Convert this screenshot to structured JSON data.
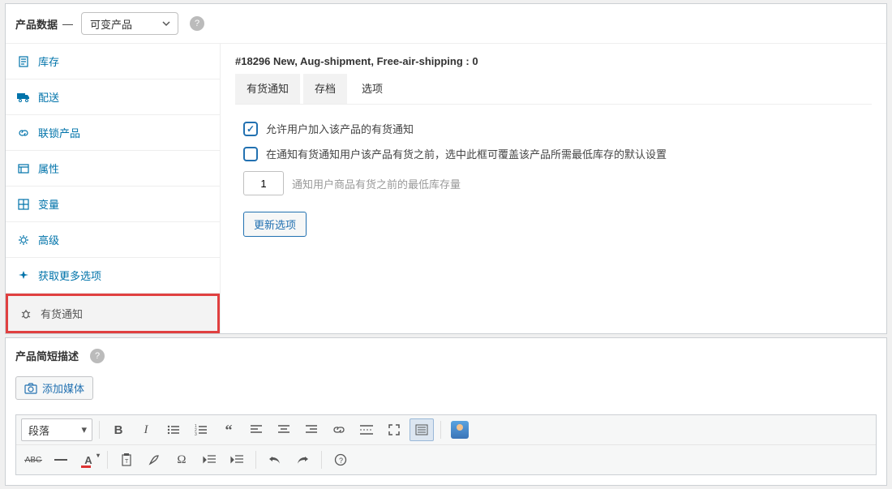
{
  "product_data": {
    "title": "产品数据",
    "dash": "—",
    "type_select": "可变产品",
    "variation_title": "#18296 New, Aug-shipment, Free-air-shipping : 0",
    "inner_tabs": {
      "t0": "有货通知",
      "t1": "存档",
      "t2": "选项"
    },
    "options": {
      "allow_join": "允许用户加入该产品的有货通知",
      "override_min": "在通知有货通知用户该产品有货之前，选中此框可覆盖该产品所需最低库存的默认设置",
      "min_value": "1",
      "min_hint": "通知用户商品有货之前的最低库存量"
    },
    "save_btn": "更新选项",
    "tabs": {
      "inventory": "库存",
      "shipping": "配送",
      "linked": "联锁产品",
      "attributes": "属性",
      "variations": "变量",
      "advanced": "高级",
      "more": "获取更多选项",
      "stock_notify": "有货通知"
    }
  },
  "short_desc": {
    "title": "产品简短描述",
    "add_media": "添加媒体",
    "format": "段落",
    "abc_label": "ABC"
  }
}
